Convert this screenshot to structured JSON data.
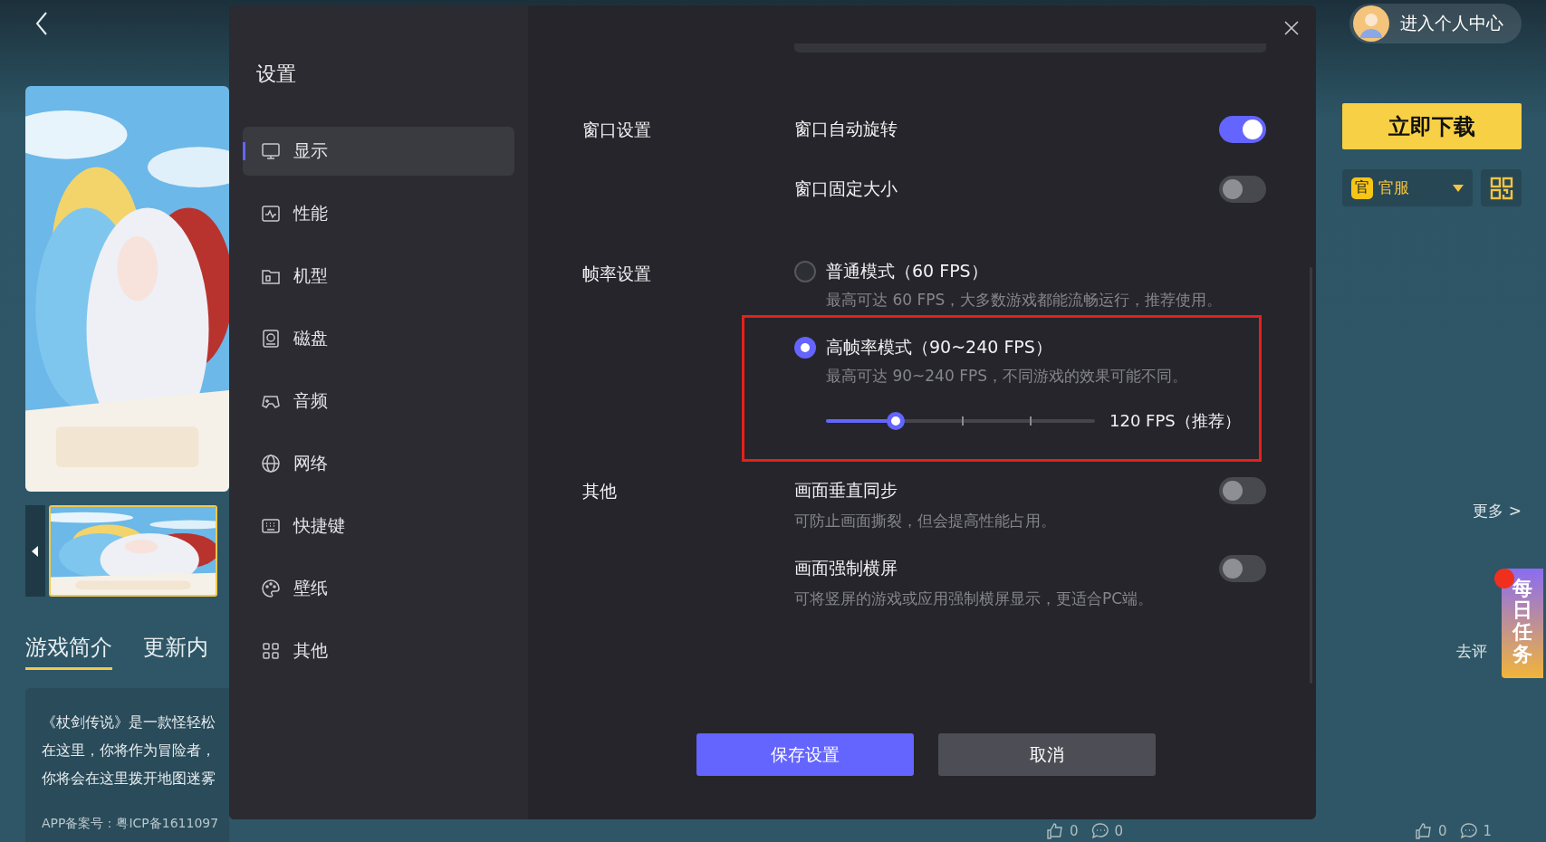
{
  "left_panel": {
    "tabs": [
      {
        "label": "游戏简介",
        "selected": true
      },
      {
        "label": "更新内",
        "selected": false
      }
    ],
    "description_lines": [
      "《杖剑传说》是一款怪轻松",
      "在这里，你将作为冒险者，",
      "你将会在这里拨开地图迷雾"
    ],
    "record": "APP备案号：粤ICP备1611097"
  },
  "right_panel": {
    "profile_link": "进入个人中心",
    "download_button": "立即下载",
    "server_select": {
      "badge": "官",
      "value": "官服"
    },
    "more_link": "更多 >",
    "comment_link": "去评",
    "daily_task": "每日任务"
  },
  "footer_stats": [
    {
      "kind": "like",
      "count": "0"
    },
    {
      "kind": "comment",
      "count": "0"
    },
    {
      "kind": "like",
      "count": "0"
    },
    {
      "kind": "comment",
      "count": "1"
    }
  ],
  "dialog": {
    "title": "设置",
    "nav": [
      {
        "label": "显示",
        "selected": true
      },
      {
        "label": "性能",
        "selected": false
      },
      {
        "label": "机型",
        "selected": false
      },
      {
        "label": "磁盘",
        "selected": false
      },
      {
        "label": "音频",
        "selected": false
      },
      {
        "label": "网络",
        "selected": false
      },
      {
        "label": "快捷键",
        "selected": false
      },
      {
        "label": "壁纸",
        "selected": false
      },
      {
        "label": "其他",
        "selected": false
      }
    ],
    "sections": [
      {
        "label": "窗口设置",
        "items": [
          {
            "kind": "toggle",
            "label": "窗口自动旋转",
            "on": true
          },
          {
            "kind": "toggle",
            "label": "窗口固定大小",
            "on": false
          }
        ]
      },
      {
        "label": "帧率设置",
        "items": [
          {
            "kind": "radio",
            "label": "普通模式（60 FPS）",
            "description": "最高可达 60 FPS，大多数游戏都能流畅运行，推荐使用。",
            "selected": false,
            "highlighted": false
          },
          {
            "kind": "radio",
            "label": "高帧率模式（90~240 FPS）",
            "description": "最高可达 90~240 FPS，不同游戏的效果可能不同。",
            "selected": true,
            "highlighted": true,
            "slider": {
              "level": 0.26,
              "reading": "120 FPS（推荐）"
            }
          }
        ]
      },
      {
        "label": "其他",
        "items": [
          {
            "kind": "toggle",
            "label": "画面垂直同步",
            "description": "可防止画面撕裂，但会提高性能占用。",
            "on": false
          },
          {
            "kind": "toggle",
            "label": "画面强制横屏",
            "description": "可将竖屏的游戏或应用强制横屏显示，更适合PC端。",
            "on": false
          }
        ]
      }
    ],
    "buttons": [
      {
        "kind": "primary",
        "label": "保存设置"
      },
      {
        "kind": "secondary",
        "label": "取消"
      }
    ]
  }
}
